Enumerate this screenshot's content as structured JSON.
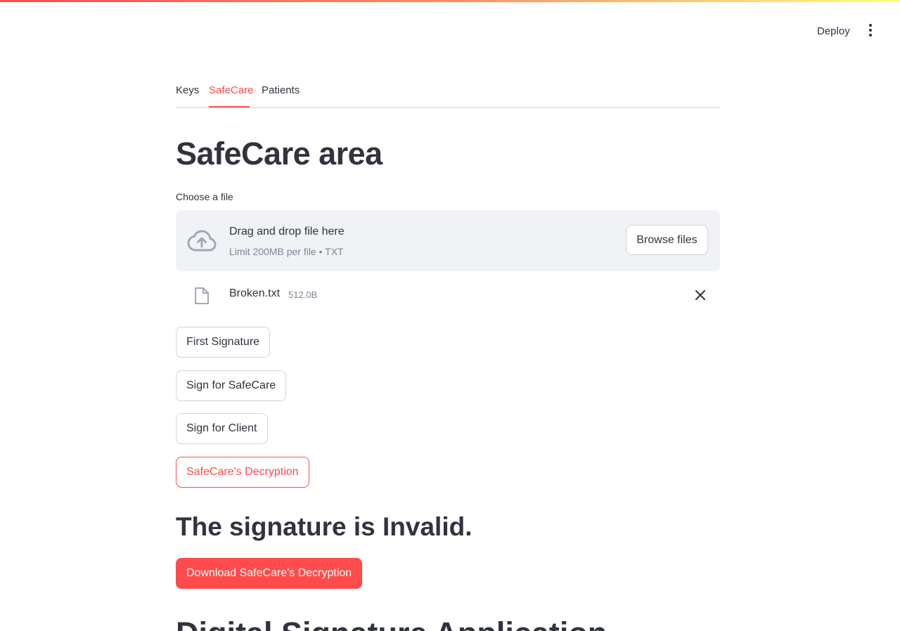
{
  "header": {
    "deploy_label": "Deploy",
    "menu_icon": "kebab-menu-icon"
  },
  "tabs": [
    {
      "label": "Keys",
      "active": false
    },
    {
      "label": "SafeCare",
      "active": true
    },
    {
      "label": "Patients",
      "active": false
    }
  ],
  "page": {
    "title": "SafeCare area"
  },
  "uploader": {
    "label": "Choose a file",
    "drop_text": "Drag and drop file here",
    "limit_text": "Limit 200MB per file • TXT",
    "browse_label": "Browse files",
    "icon": "cloud-upload-icon"
  },
  "uploaded_file": {
    "name": "Broken.txt",
    "size": "512.0B",
    "icon": "file-icon",
    "remove_icon": "close-icon"
  },
  "buttons": {
    "first_signature": "First Signature",
    "sign_safecare": "Sign for SafeCare",
    "sign_client": "Sign for Client",
    "decryption": "SafeCare's Decryption",
    "download": "Download SafeCare's Decryption"
  },
  "result": {
    "message": "The signature is Invalid."
  },
  "next_section": {
    "title": "Digital Signature Application"
  },
  "colors": {
    "accent": "#ff4b4b",
    "text": "#31333f",
    "dropzone_bg": "#f0f2f6",
    "muted": "#808495"
  }
}
